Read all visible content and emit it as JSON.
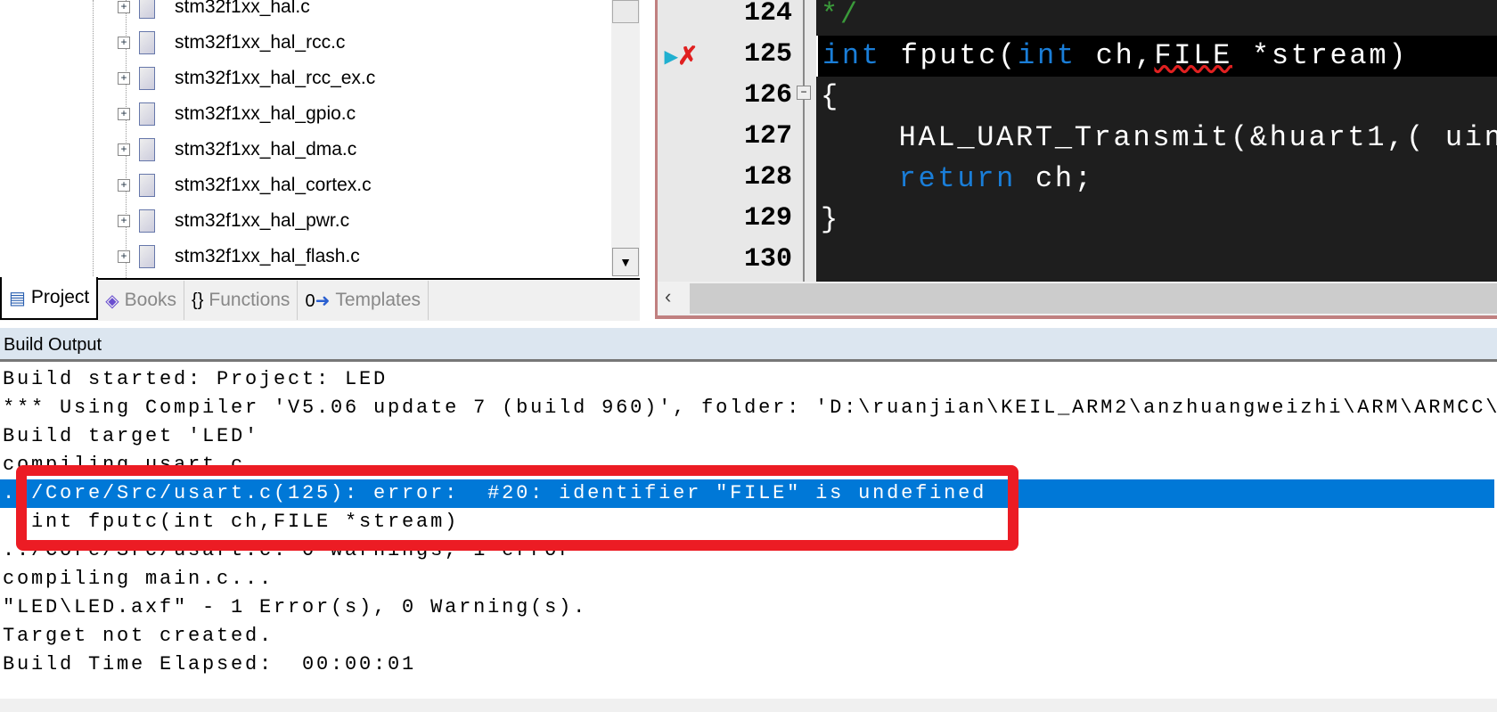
{
  "project_tree": {
    "files": [
      "stm32f1xx_hal.c",
      "stm32f1xx_hal_rcc.c",
      "stm32f1xx_hal_rcc_ex.c",
      "stm32f1xx_hal_gpio.c",
      "stm32f1xx_hal_dma.c",
      "stm32f1xx_hal_cortex.c",
      "stm32f1xx_hal_pwr.c",
      "stm32f1xx_hal_flash.c"
    ]
  },
  "panel_tabs": [
    {
      "label": "Project",
      "icon": "project-icon"
    },
    {
      "label": "Books",
      "icon": "books-icon"
    },
    {
      "label": "Functions",
      "icon": "functions-icon"
    },
    {
      "label": "Templates",
      "icon": "templates-icon"
    }
  ],
  "editor": {
    "lines": [
      {
        "num": "124",
        "text": "*/"
      },
      {
        "num": "125",
        "text": "int fputc(int ch,FILE *stream)"
      },
      {
        "num": "126",
        "text": "{"
      },
      {
        "num": "127",
        "text": "    HAL_UART_Transmit(&huart1,( uin"
      },
      {
        "num": "128",
        "text": "    return ch;"
      },
      {
        "num": "129",
        "text": "}"
      },
      {
        "num": "130",
        "text": ""
      }
    ],
    "error_line": "125"
  },
  "build_output": {
    "title": "Build Output",
    "lines": [
      "Build started: Project: LED",
      "*** Using Compiler 'V5.06 update 7 (build 960)', folder: 'D:\\ruanjian\\KEIL_ARM2\\anzhuangweizhi\\ARM\\ARMCC\\",
      "Build target 'LED'",
      "compiling usart.c...",
      "../Core/Src/usart.c(125): error:  #20: identifier \"FILE\" is undefined",
      "  int fputc(int ch,FILE *stream)",
      "../Core/Src/usart.c: 0 warnings, 1 error",
      "compiling main.c...",
      "\"LED\\LED.axf\" - 1 Error(s), 0 Warning(s).",
      "Target not created.",
      "Build Time Elapsed:  00:00:01"
    ],
    "selected_index": 4
  },
  "colors": {
    "selection": "#0078d7",
    "annotation": "#ec1c24",
    "keyword": "#1a7ed8",
    "editor_bg": "#1e1e1e"
  }
}
